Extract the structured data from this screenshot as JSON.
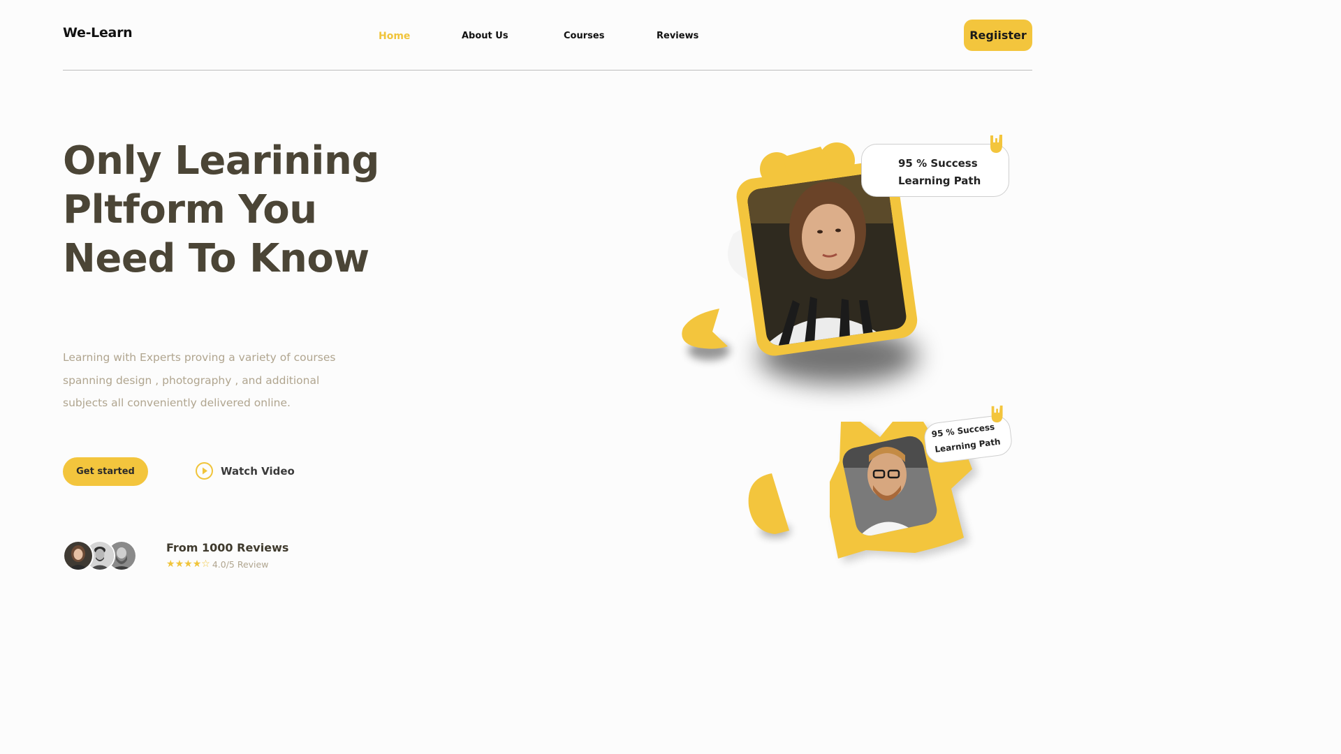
{
  "header": {
    "brand": "We-Learn",
    "nav": [
      "Home",
      "About Us",
      "Courses",
      "Reviews"
    ],
    "register_label": "Regiister"
  },
  "hero": {
    "title_lines": [
      "Only Learining",
      "Pltform You",
      "Need To Know"
    ],
    "description_lines": [
      "Learning with Experts proving a variety of courses",
      "spanning design , photography , and additional",
      "subjects  all conveniently delivered online."
    ],
    "get_started_label": "Get started",
    "watch_video_label": "Watch Video"
  },
  "reviews": {
    "heading": "From 1000 Reviews",
    "rating": 4.0,
    "rating_max": 5,
    "rating_text": "4.0/5 Review"
  },
  "cards": {
    "top": {
      "line1": "95 % Success",
      "line2": "Learning Path"
    },
    "bottom": {
      "line1": "95 % Success",
      "line2": "Learning Path"
    }
  },
  "colors": {
    "accent": "#f3c53d",
    "heading": "#4b4536",
    "muted": "#b0a58f",
    "background": "#fcfcfc"
  },
  "icons": [
    "play-icon",
    "rock-hand-icon",
    "star-icon"
  ]
}
